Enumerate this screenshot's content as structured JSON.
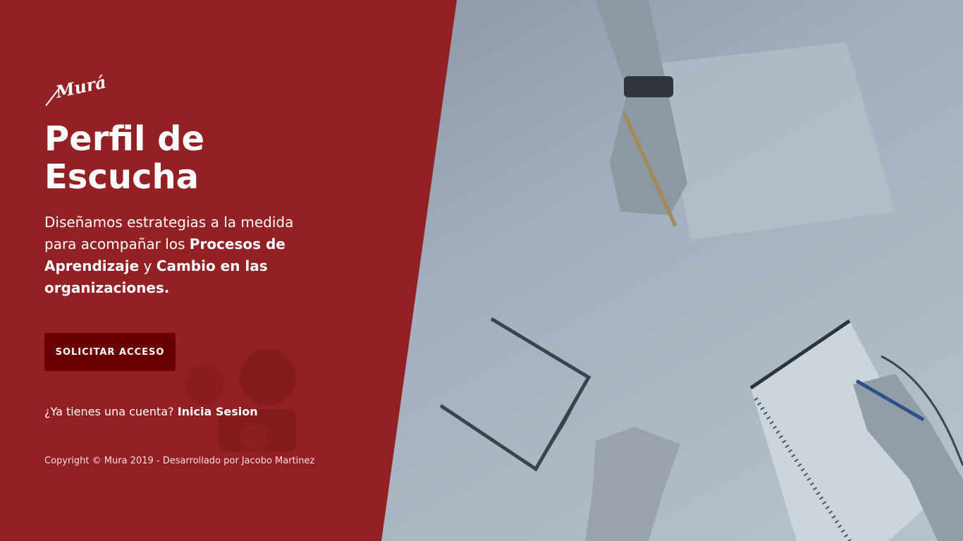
{
  "brand": {
    "logo_text": "Murá"
  },
  "hero": {
    "title_line1": "Perfil de",
    "title_line2": "Escucha",
    "desc_part1": "Diseñamos estrategias a la medida para acompañar los ",
    "desc_bold1": "Procesos de Aprendizaje",
    "desc_part2": " y ",
    "desc_bold2": "Cambio en las organizaciones."
  },
  "actions": {
    "request_access_label": "SOLICITAR ACCESO",
    "login_prompt": "¿Ya tienes una cuenta?",
    "login_link_label": "Inicia Sesion"
  },
  "footer": {
    "copyright": "Copyright © Mura 2019 - Desarrollado por Jacobo Martinez"
  },
  "colors": {
    "panel_red": "#932024",
    "button_dark_red": "#6a0004",
    "photo_overlay": "#8a97a6"
  }
}
